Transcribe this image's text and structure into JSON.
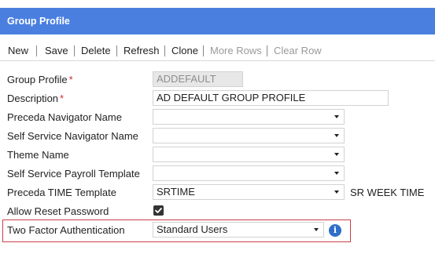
{
  "header": {
    "title": "Group Profile"
  },
  "toolbar": {
    "new_label": "New",
    "save_label": "Save",
    "delete_label": "Delete",
    "refresh_label": "Refresh",
    "clone_label": "Clone",
    "more_rows_label": "More Rows",
    "clear_row_label": "Clear Row"
  },
  "form": {
    "group_profile": {
      "label": "Group Profile",
      "required_mark": "*",
      "value": "ADDEFAULT"
    },
    "description": {
      "label": "Description",
      "required_mark": "*",
      "value": "AD DEFAULT GROUP PROFILE"
    },
    "preceda_navigator_name": {
      "label": "Preceda Navigator Name",
      "value": ""
    },
    "self_service_navigator_name": {
      "label": "Self Service Navigator Name",
      "value": ""
    },
    "theme_name": {
      "label": "Theme Name",
      "value": ""
    },
    "self_service_payroll_template": {
      "label": "Self Service Payroll Template",
      "value": ""
    },
    "preceda_time_template": {
      "label": "Preceda TIME Template",
      "value": "SRTIME",
      "description": "SR WEEK TIME"
    },
    "allow_reset_password": {
      "label": "Allow Reset Password",
      "checked": true
    },
    "two_factor_authentication": {
      "label": "Two Factor Authentication",
      "value": "Standard Users",
      "info_icon": "info-icon"
    }
  },
  "colors": {
    "header_bg": "#4a7fe0",
    "required": "#d32f2f",
    "highlight_border": "#c8404a",
    "info_icon": "#2f6ec8",
    "disabled_text": "#9a9a9a"
  }
}
